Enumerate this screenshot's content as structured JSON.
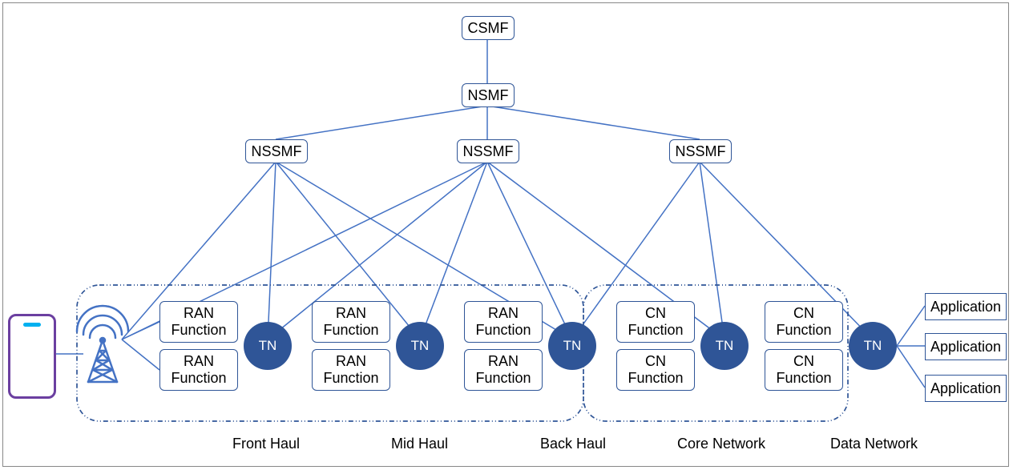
{
  "hierarchy": {
    "csmf": "CSMF",
    "nsmf": "NSMF",
    "nssmf": [
      "NSSMF",
      "NSSMF",
      "NSSMF"
    ]
  },
  "functions": {
    "ran": [
      "RAN\nFunction",
      "RAN\nFunction",
      "RAN\nFunction",
      "RAN\nFunction",
      "RAN\nFunction",
      "RAN\nFunction"
    ],
    "cn": [
      "CN\nFunction",
      "CN\nFunction",
      "CN\nFunction",
      "CN\nFunction"
    ],
    "tn": [
      "TN",
      "TN",
      "TN",
      "TN",
      "TN"
    ]
  },
  "applications": [
    "Application",
    "Application",
    "Application"
  ],
  "segments": {
    "front_haul": "Front Haul",
    "mid_haul": "Mid Haul",
    "back_haul": "Back Haul",
    "core_network": "Core Network",
    "data_network": "Data Network"
  },
  "device": {
    "type": "mobile-phone"
  },
  "radio": {
    "type": "cell-tower"
  }
}
